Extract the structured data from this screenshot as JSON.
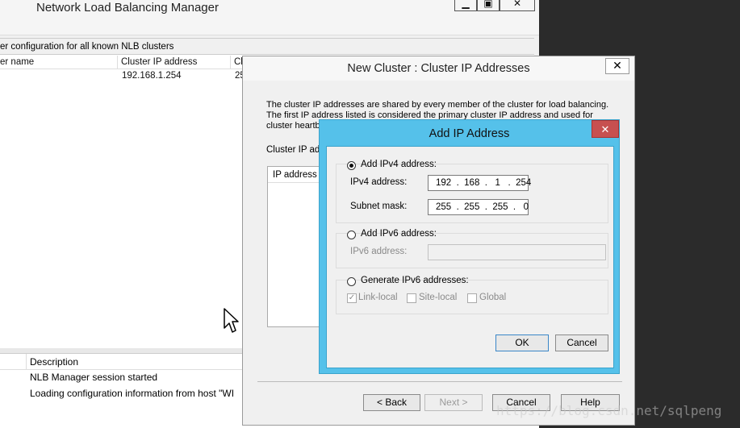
{
  "manager": {
    "title": "Network Load Balancing Manager",
    "minimize": "▁",
    "maximize": "▣",
    "close": "✕",
    "clusters_caption": "er configuration for all known NLB clusters",
    "columns": [
      "er name",
      "Cluster IP address",
      "Cl"
    ],
    "rows": [
      {
        "name": "",
        "ip": "192.168.1.254",
        "extra": "25"
      }
    ],
    "log_columns": [
      "",
      "Description"
    ],
    "log_lines": [
      "NLB Manager session started",
      "Loading configuration information from host \"WI"
    ]
  },
  "new_cluster": {
    "title": "New Cluster :  Cluster IP Addresses",
    "close": "✕",
    "description": "The cluster IP addresses are shared by every member of the cluster for load balancing. The first IP address listed is considered the primary cluster IP address and used for cluster heartbeats.",
    "list_label": "Cluster IP add",
    "list_header": "IP address",
    "buttons": {
      "back": "< Back",
      "next": "Next >",
      "cancel": "Cancel",
      "help": "Help"
    }
  },
  "add_ip": {
    "title": "Add IP Address",
    "close": "✕",
    "ipv4_radio": "Add IPv4 address:",
    "ipv4_label": "IPv4 address:",
    "ipv4_value": "192  .  168  .   1   .  254",
    "mask_label": "Subnet mask:",
    "mask_value": "255  .  255  .  255  .   0",
    "ipv6_radio": "Add IPv6 address:",
    "ipv6_label": "IPv6 address:",
    "ipv6_value": "",
    "gen_radio": "Generate IPv6 addresses:",
    "link_local": "Link-local",
    "site_local": "Site-local",
    "global": "Global",
    "ok": "OK",
    "cancel": "Cancel"
  },
  "watermark": "https://blog.csdn.net/sqlpeng"
}
